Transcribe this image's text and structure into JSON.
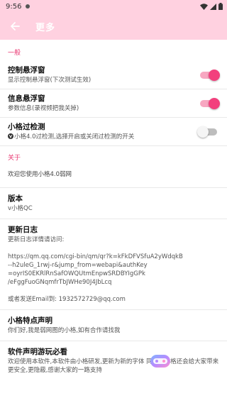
{
  "status_bar": {
    "time": "9:56"
  },
  "app_bar": {
    "title": "更多",
    "back_icon": "arrow-left-icon"
  },
  "sections": {
    "general": "一般",
    "about": "关于"
  },
  "prefs": {
    "float_control": {
      "title": "控制悬浮窗",
      "summary": "显示控制悬浮窗(下次测试生效)",
      "enabled": true
    },
    "float_info": {
      "title": "信息悬浮窗",
      "summary": "参数信息(录视频把我关掉)",
      "enabled": true
    },
    "detect": {
      "title": "小格过检测",
      "summary": "小格4.0过检测,选择开启或关闭过检测的开关",
      "enabled": false
    }
  },
  "about": {
    "welcome": "欢迎您使用小格4.0弱网",
    "version": {
      "title": "版本",
      "summary": "v小格QC"
    },
    "changelog": {
      "title": "更新日志",
      "summary": "更新日志详情请访问:\n\nhttps://qm.qq.com/cgi-bin/qm/qr?k=kFkDFVSfuA2yWdqkB\n--h2uleG_1rwj-r&jump_from=webapi&authKey\n=oyrIS0EKRlRnSafOWQUtmEnpwSRDBYIgGPk\n/eFggFuoGNqmfrTbJWHe90J4JbLcq\n\n或者发送Email到: 1932572729@qq.com"
    },
    "features": {
      "title": "小格特点声明",
      "summary": "你们好,我是弱网图的小格,如有合作请找我"
    },
    "disclaimer": {
      "title": "软件声明游玩必看",
      "summary": "欢迎使用本软件,本软件由小格研发,更新为新的字体 同时我小格还会给大家带来更安全,更隐蔽,感谢大家的一路支持"
    }
  },
  "colors": {
    "accent": "#e93872",
    "app_bar": "#ffd1e0"
  },
  "fab_icon": "gamepad-icon"
}
